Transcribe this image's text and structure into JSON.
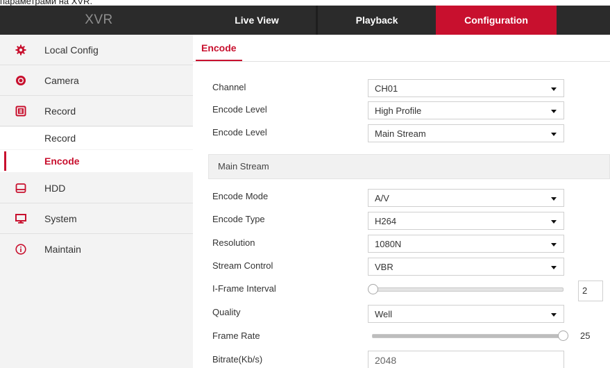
{
  "caption": "параметрами на XVR.",
  "header": {
    "logo": "XVR",
    "tabs": [
      {
        "label": "Live View"
      },
      {
        "label": "Playback"
      },
      {
        "label": "Configuration"
      }
    ]
  },
  "sidebar": {
    "items": [
      {
        "label": "Local Config",
        "icon": "gear-icon"
      },
      {
        "label": "Camera",
        "icon": "camera-icon"
      },
      {
        "label": "Record",
        "icon": "record-icon"
      },
      {
        "label": "HDD",
        "icon": "hdd-icon"
      },
      {
        "label": "System",
        "icon": "monitor-icon"
      },
      {
        "label": "Maintain",
        "icon": "info-icon"
      }
    ],
    "sub_items": [
      {
        "label": "Record"
      },
      {
        "label": "Encode"
      }
    ]
  },
  "main": {
    "tab": "Encode",
    "section": "Main Stream",
    "fields": {
      "channel": {
        "label": "Channel",
        "value": "CH01"
      },
      "encode_level_profile": {
        "label": "Encode Level",
        "value": "High Profile"
      },
      "encode_level_stream": {
        "label": "Encode Level",
        "value": "Main Stream"
      },
      "encode_mode": {
        "label": "Encode Mode",
        "value": "A/V"
      },
      "encode_type": {
        "label": "Encode Type",
        "value": "H264"
      },
      "resolution": {
        "label": "Resolution",
        "value": "1080N"
      },
      "stream_control": {
        "label": "Stream Control",
        "value": "VBR"
      },
      "iframe_interval": {
        "label": "I-Frame Interval",
        "value": "2",
        "level": 0.0
      },
      "quality": {
        "label": "Quality",
        "value": "Well"
      },
      "frame_rate": {
        "label": "Frame Rate",
        "value": "25",
        "level": 1.0
      },
      "bitrate": {
        "label": "Bitrate(Kb/s)",
        "value": "2048"
      }
    }
  },
  "colors": {
    "accent": "#c8102e",
    "topbar": "#2b2b2b",
    "sidebar": "#f3f3f3"
  }
}
